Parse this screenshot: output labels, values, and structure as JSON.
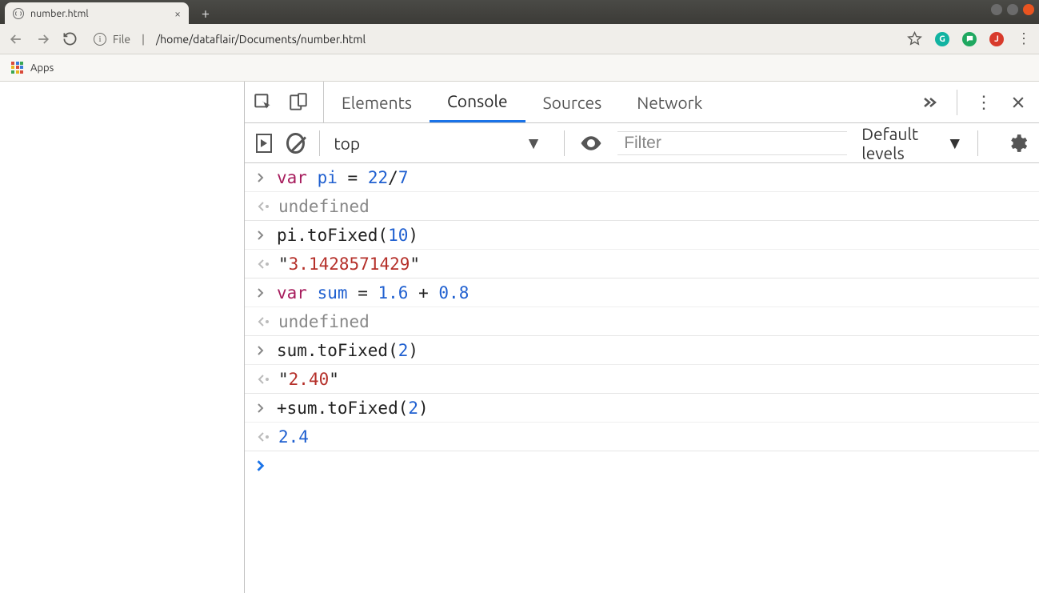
{
  "window": {
    "tab_title": "number.html"
  },
  "toolbar": {
    "url_protocol": "File",
    "url_path": "/home/dataflair/Documents/number.html",
    "profile_letter": "J",
    "ext_g_letter": "G"
  },
  "bookmarks": {
    "apps_label": "Apps"
  },
  "devtools": {
    "tabs": {
      "elements": "Elements",
      "console": "Console",
      "sources": "Sources",
      "network": "Network"
    },
    "subbar": {
      "context": "top",
      "filter_placeholder": "Filter",
      "levels_label": "Default levels"
    },
    "console": {
      "rows": [
        {
          "type": "in",
          "tokens": [
            [
              "kw",
              "var"
            ],
            [
              "sp",
              " "
            ],
            [
              "ident",
              "pi"
            ],
            [
              "sp",
              " "
            ],
            [
              "op",
              "="
            ],
            [
              "sp",
              " "
            ],
            [
              "num",
              "22"
            ],
            [
              "op",
              "/"
            ],
            [
              "num",
              "7"
            ]
          ]
        },
        {
          "type": "out",
          "tokens": [
            [
              "undef",
              "undefined"
            ]
          ]
        },
        {
          "type": "in",
          "tokens": [
            [
              "txt",
              "pi.toFixed("
            ],
            [
              "num",
              "10"
            ],
            [
              "txt",
              ")"
            ]
          ]
        },
        {
          "type": "out",
          "tokens": [
            [
              "txt",
              "\""
            ],
            [
              "str",
              "3.1428571429"
            ],
            [
              "txt",
              "\""
            ]
          ]
        },
        {
          "type": "in",
          "tokens": [
            [
              "kw",
              "var"
            ],
            [
              "sp",
              " "
            ],
            [
              "ident",
              "sum"
            ],
            [
              "sp",
              " "
            ],
            [
              "op",
              "="
            ],
            [
              "sp",
              " "
            ],
            [
              "num",
              "1.6"
            ],
            [
              "sp",
              " "
            ],
            [
              "op",
              "+"
            ],
            [
              "sp",
              " "
            ],
            [
              "num",
              "0.8"
            ]
          ]
        },
        {
          "type": "out",
          "tokens": [
            [
              "undef",
              "undefined"
            ]
          ]
        },
        {
          "type": "in",
          "tokens": [
            [
              "txt",
              "sum.toFixed("
            ],
            [
              "num",
              "2"
            ],
            [
              "txt",
              ")"
            ]
          ]
        },
        {
          "type": "out",
          "tokens": [
            [
              "txt",
              "\""
            ],
            [
              "str",
              "2.40"
            ],
            [
              "txt",
              "\""
            ]
          ]
        },
        {
          "type": "in",
          "tokens": [
            [
              "txt",
              "+sum.toFixed("
            ],
            [
              "num",
              "2"
            ],
            [
              "txt",
              ")"
            ]
          ]
        },
        {
          "type": "out",
          "tokens": [
            [
              "num",
              "2.4"
            ]
          ]
        }
      ]
    }
  }
}
